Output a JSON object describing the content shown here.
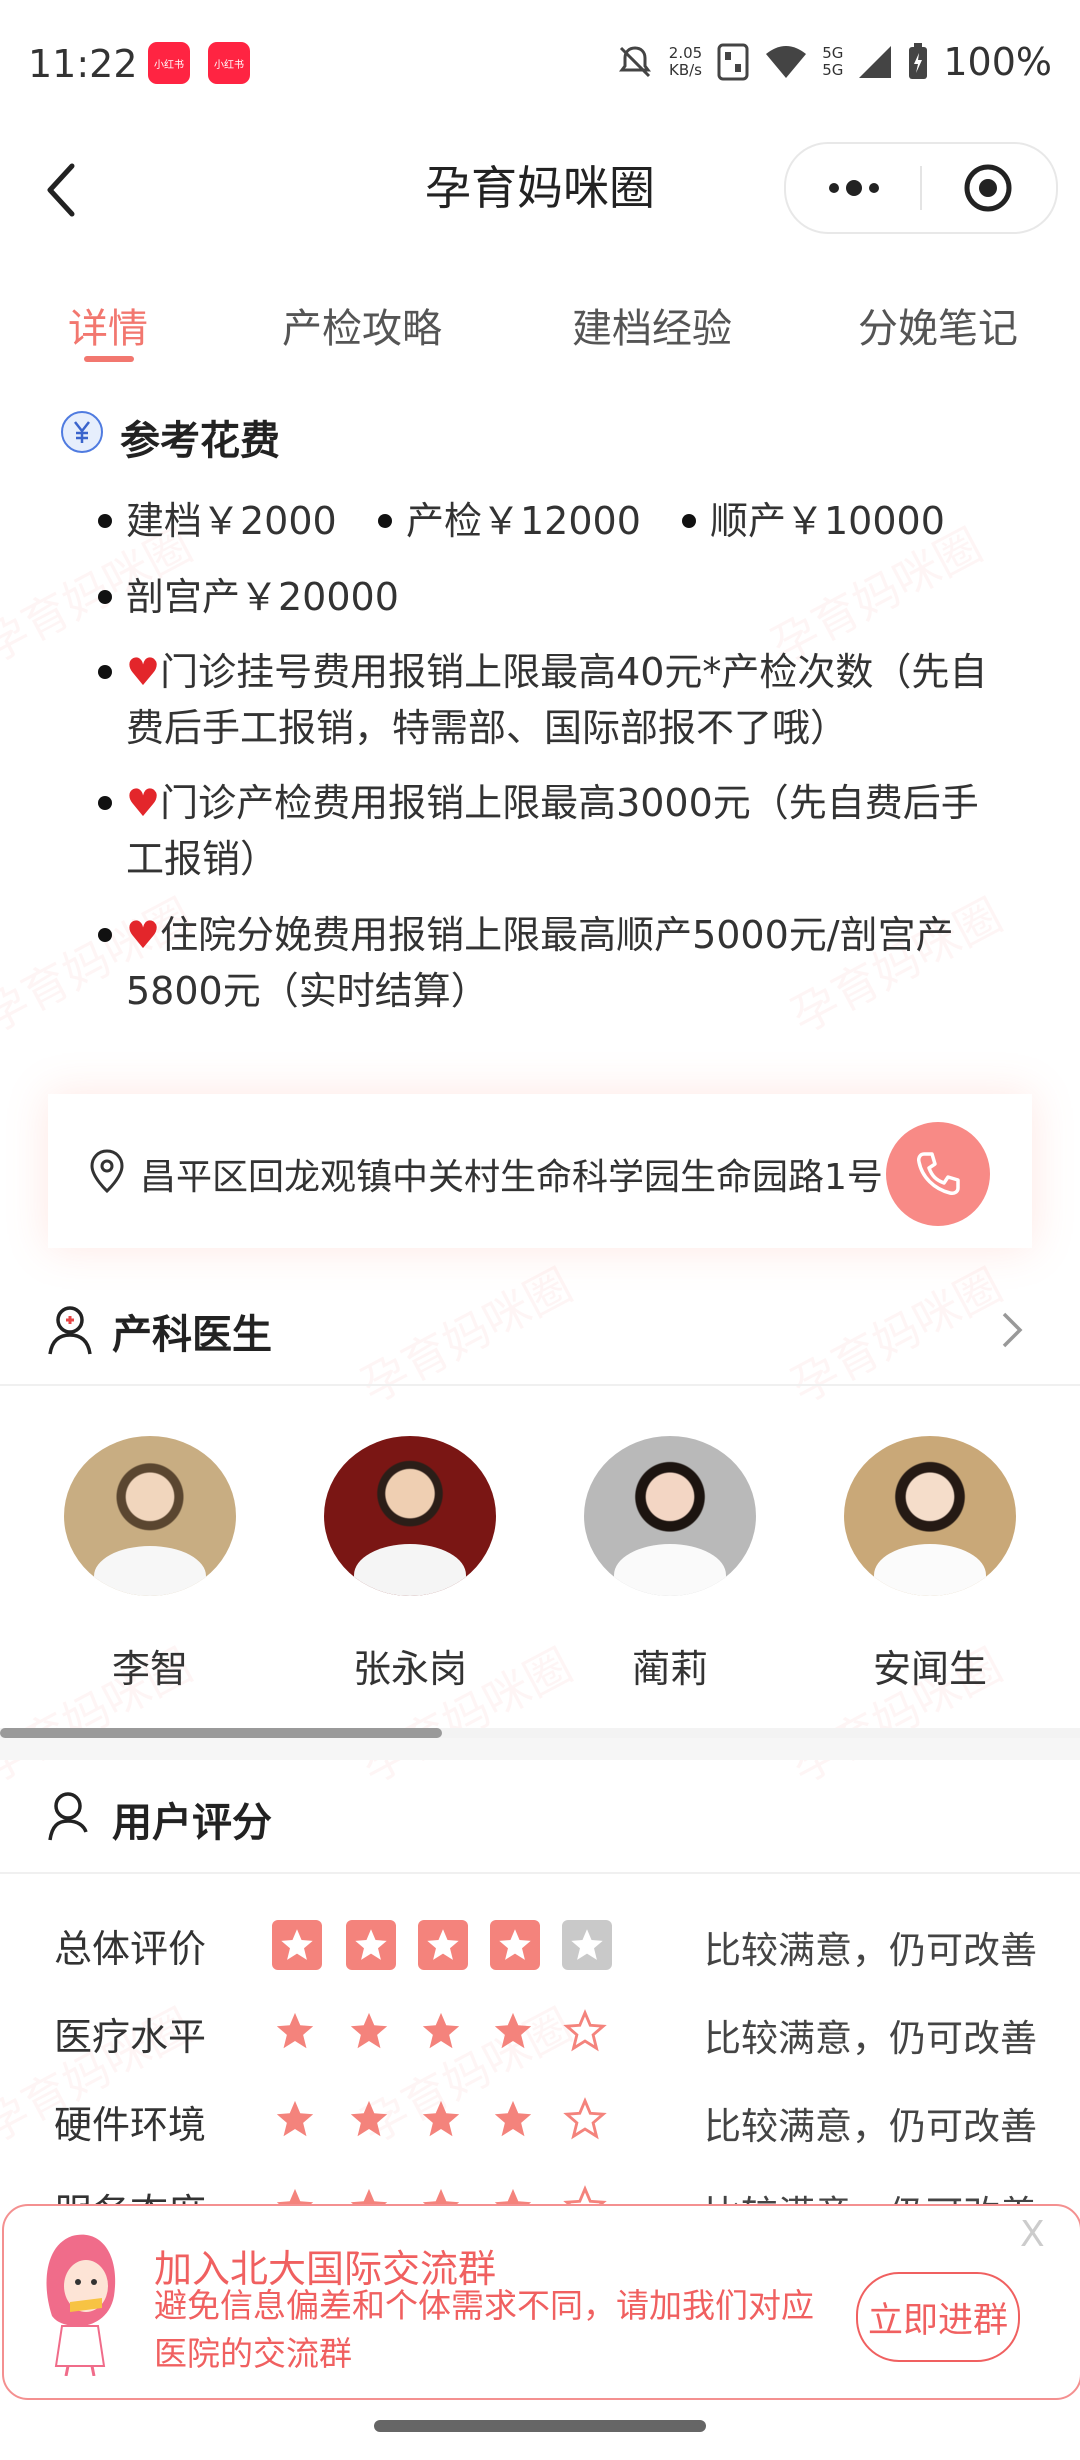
{
  "status_bar": {
    "time": "11:22",
    "app_badges": [
      "小红书",
      "小红书"
    ],
    "net_speed_value": "2.05",
    "net_speed_unit": "KB/s",
    "signal_label_1": "5G",
    "signal_label_2": "5G",
    "battery": "100%"
  },
  "nav": {
    "title": "孕育妈咪圈"
  },
  "tabs": [
    {
      "label": "详情",
      "active": true
    },
    {
      "label": "产检攻略",
      "active": false
    },
    {
      "label": "建档经验",
      "active": false
    },
    {
      "label": "分娩笔记",
      "active": false
    }
  ],
  "cost": {
    "title": "参考花费",
    "items": [
      "建档￥2000",
      "产检￥12000",
      "顺产￥10000",
      "剖宫产￥20000"
    ],
    "heart": "♥",
    "notes": [
      [
        "门诊挂号费用报销上限最高40元*产检次数（先自",
        "费后手工报销，特需部、国际部报不了哦）"
      ],
      [
        "门诊产检费用报销上限最高3000元（先自费后手",
        "工报销）"
      ],
      [
        "住院分娩费用报销上限最高顺产5000元/剖宫产",
        "5800元（实时结算）"
      ]
    ]
  },
  "address": "昌平区回龙观镇中关村生命科学园生命园路1号",
  "doctors": {
    "title": "产科医生",
    "list": [
      {
        "name": "李智"
      },
      {
        "name": "张永岗"
      },
      {
        "name": "蔺莉"
      },
      {
        "name": "安闻生"
      }
    ]
  },
  "ratings": {
    "title": "用户评分",
    "rows": [
      {
        "label": "总体评价",
        "stars": 4,
        "text": "比较满意，仍可改善"
      },
      {
        "label": "医疗水平",
        "stars": 4,
        "text": "比较满意，仍可改善"
      },
      {
        "label": "硬件环境",
        "stars": 4,
        "text": "比较满意，仍可改善"
      },
      {
        "label": "服务态度",
        "stars": 4,
        "text": "比较满意，仍可改善"
      }
    ]
  },
  "banner": {
    "title": "加入北大国际交流群",
    "subtitle": "避免信息偏差和个体需求不同，请加我们对应医院的交流群",
    "button": "立即进群",
    "close": "X"
  },
  "watermark": "孕育妈咪圈",
  "colors": {
    "accent": "#f2776f",
    "heart": "#e3262b",
    "banner": "#f06060"
  }
}
